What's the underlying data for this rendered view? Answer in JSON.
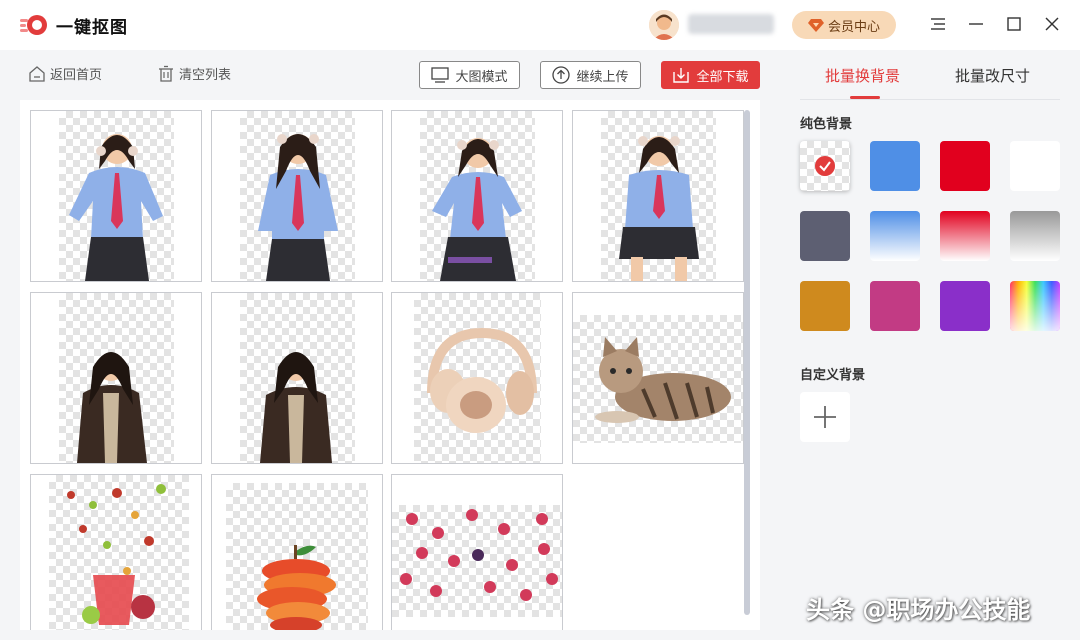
{
  "app": {
    "title": "一键抠图"
  },
  "user": {
    "vip_label": "会员中心"
  },
  "toolbar": {
    "home_label": "返回首页",
    "clear_label": "清空列表",
    "bigview_label": "大图模式",
    "upload_label": "继续上传",
    "download_label": "全部下载"
  },
  "tabs": [
    "批量换背景",
    "批量改尺寸"
  ],
  "side": {
    "solid_label": "纯色背景",
    "custom_label": "自定义背景",
    "swatches": [
      {
        "type": "transparent",
        "selected": true
      },
      {
        "type": "solid",
        "color": "#4f8fe6"
      },
      {
        "type": "solid",
        "color": "#e1001e"
      },
      {
        "type": "solid",
        "color": "#ffffff"
      },
      {
        "type": "solid",
        "color": "#5d5f72"
      },
      {
        "type": "gradient",
        "from": "#4f8fe6",
        "to": "#ffffff"
      },
      {
        "type": "gradient",
        "from": "#e1001e",
        "to": "#ffffff"
      },
      {
        "type": "gradient",
        "from": "#999999",
        "to": "#ffffff"
      },
      {
        "type": "solid",
        "color": "#cf8a1e"
      },
      {
        "type": "solid",
        "color": "#c23b84"
      },
      {
        "type": "solid",
        "color": "#8a2fc9"
      },
      {
        "type": "rainbow"
      }
    ]
  },
  "images": [
    {
      "subject": "girl-headphones-1"
    },
    {
      "subject": "girl-headphones-2"
    },
    {
      "subject": "girl-headphones-sitting"
    },
    {
      "subject": "girl-headphones-bench"
    },
    {
      "subject": "girl-jacket-1"
    },
    {
      "subject": "girl-jacket-2"
    },
    {
      "subject": "headphones"
    },
    {
      "subject": "cat"
    },
    {
      "subject": "fruit-drink"
    },
    {
      "subject": "sliced-apple"
    },
    {
      "subject": "raspberries"
    }
  ],
  "watermark": "头条 @职场办公技能",
  "colors": {
    "accent": "#e23c3c",
    "vip_bg": "#f8d9b7"
  }
}
